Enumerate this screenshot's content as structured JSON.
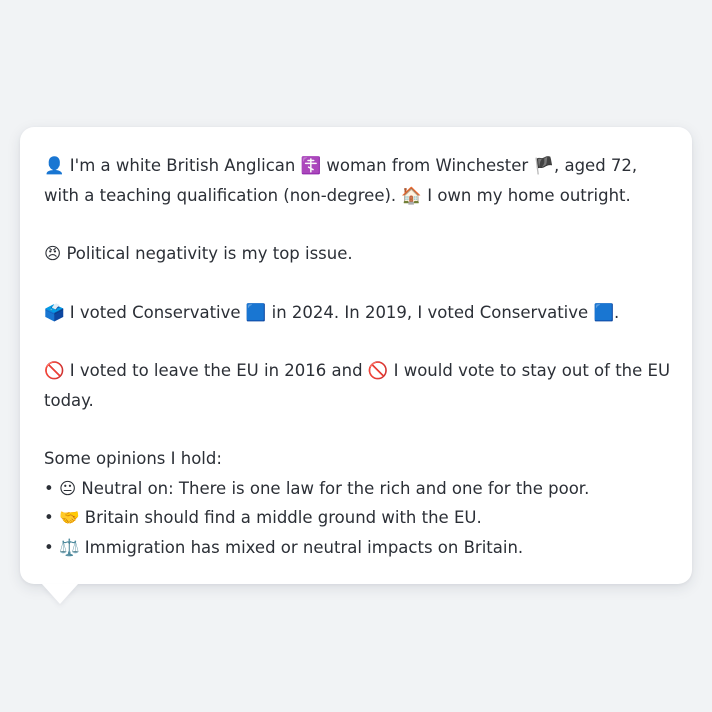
{
  "profile": {
    "line1": {
      "icon1": "👤",
      "text1": " I'm a white British Anglican ",
      "icon2": "☦️",
      "text2": " woman from Winchester ",
      "icon3": "🏴",
      "text3": ", aged 72, with a teaching qualification (non-degree). ",
      "icon4": "🏠",
      "text4": " I own my home outright."
    },
    "issue": {
      "icon": "😠",
      "text": " Political negativity is my top issue."
    },
    "vote": {
      "icon": "🗳️",
      "text1": " I voted Conservative ",
      "icon2": "🟦",
      "text2": " in 2024. In 2019, I voted Conservative ",
      "icon3": "🟦",
      "text3": "."
    },
    "eu": {
      "icon1": "🚫",
      "text1": " I voted to leave the EU in 2016 and ",
      "icon2": "🚫",
      "text2": " I would vote to stay out of the EU today."
    },
    "opinions": {
      "heading": "Some opinions I hold:",
      "items": [
        {
          "bullet": "•",
          "icon": "😐",
          "text": " Neutral on: There is one law for the rich and one for the poor."
        },
        {
          "bullet": "•",
          "icon": "🤝",
          "text": " Britain should find a middle ground with the EU."
        },
        {
          "bullet": "•",
          "icon": "⚖️",
          "text": " Immigration has mixed or neutral impacts on Britain."
        }
      ]
    }
  }
}
